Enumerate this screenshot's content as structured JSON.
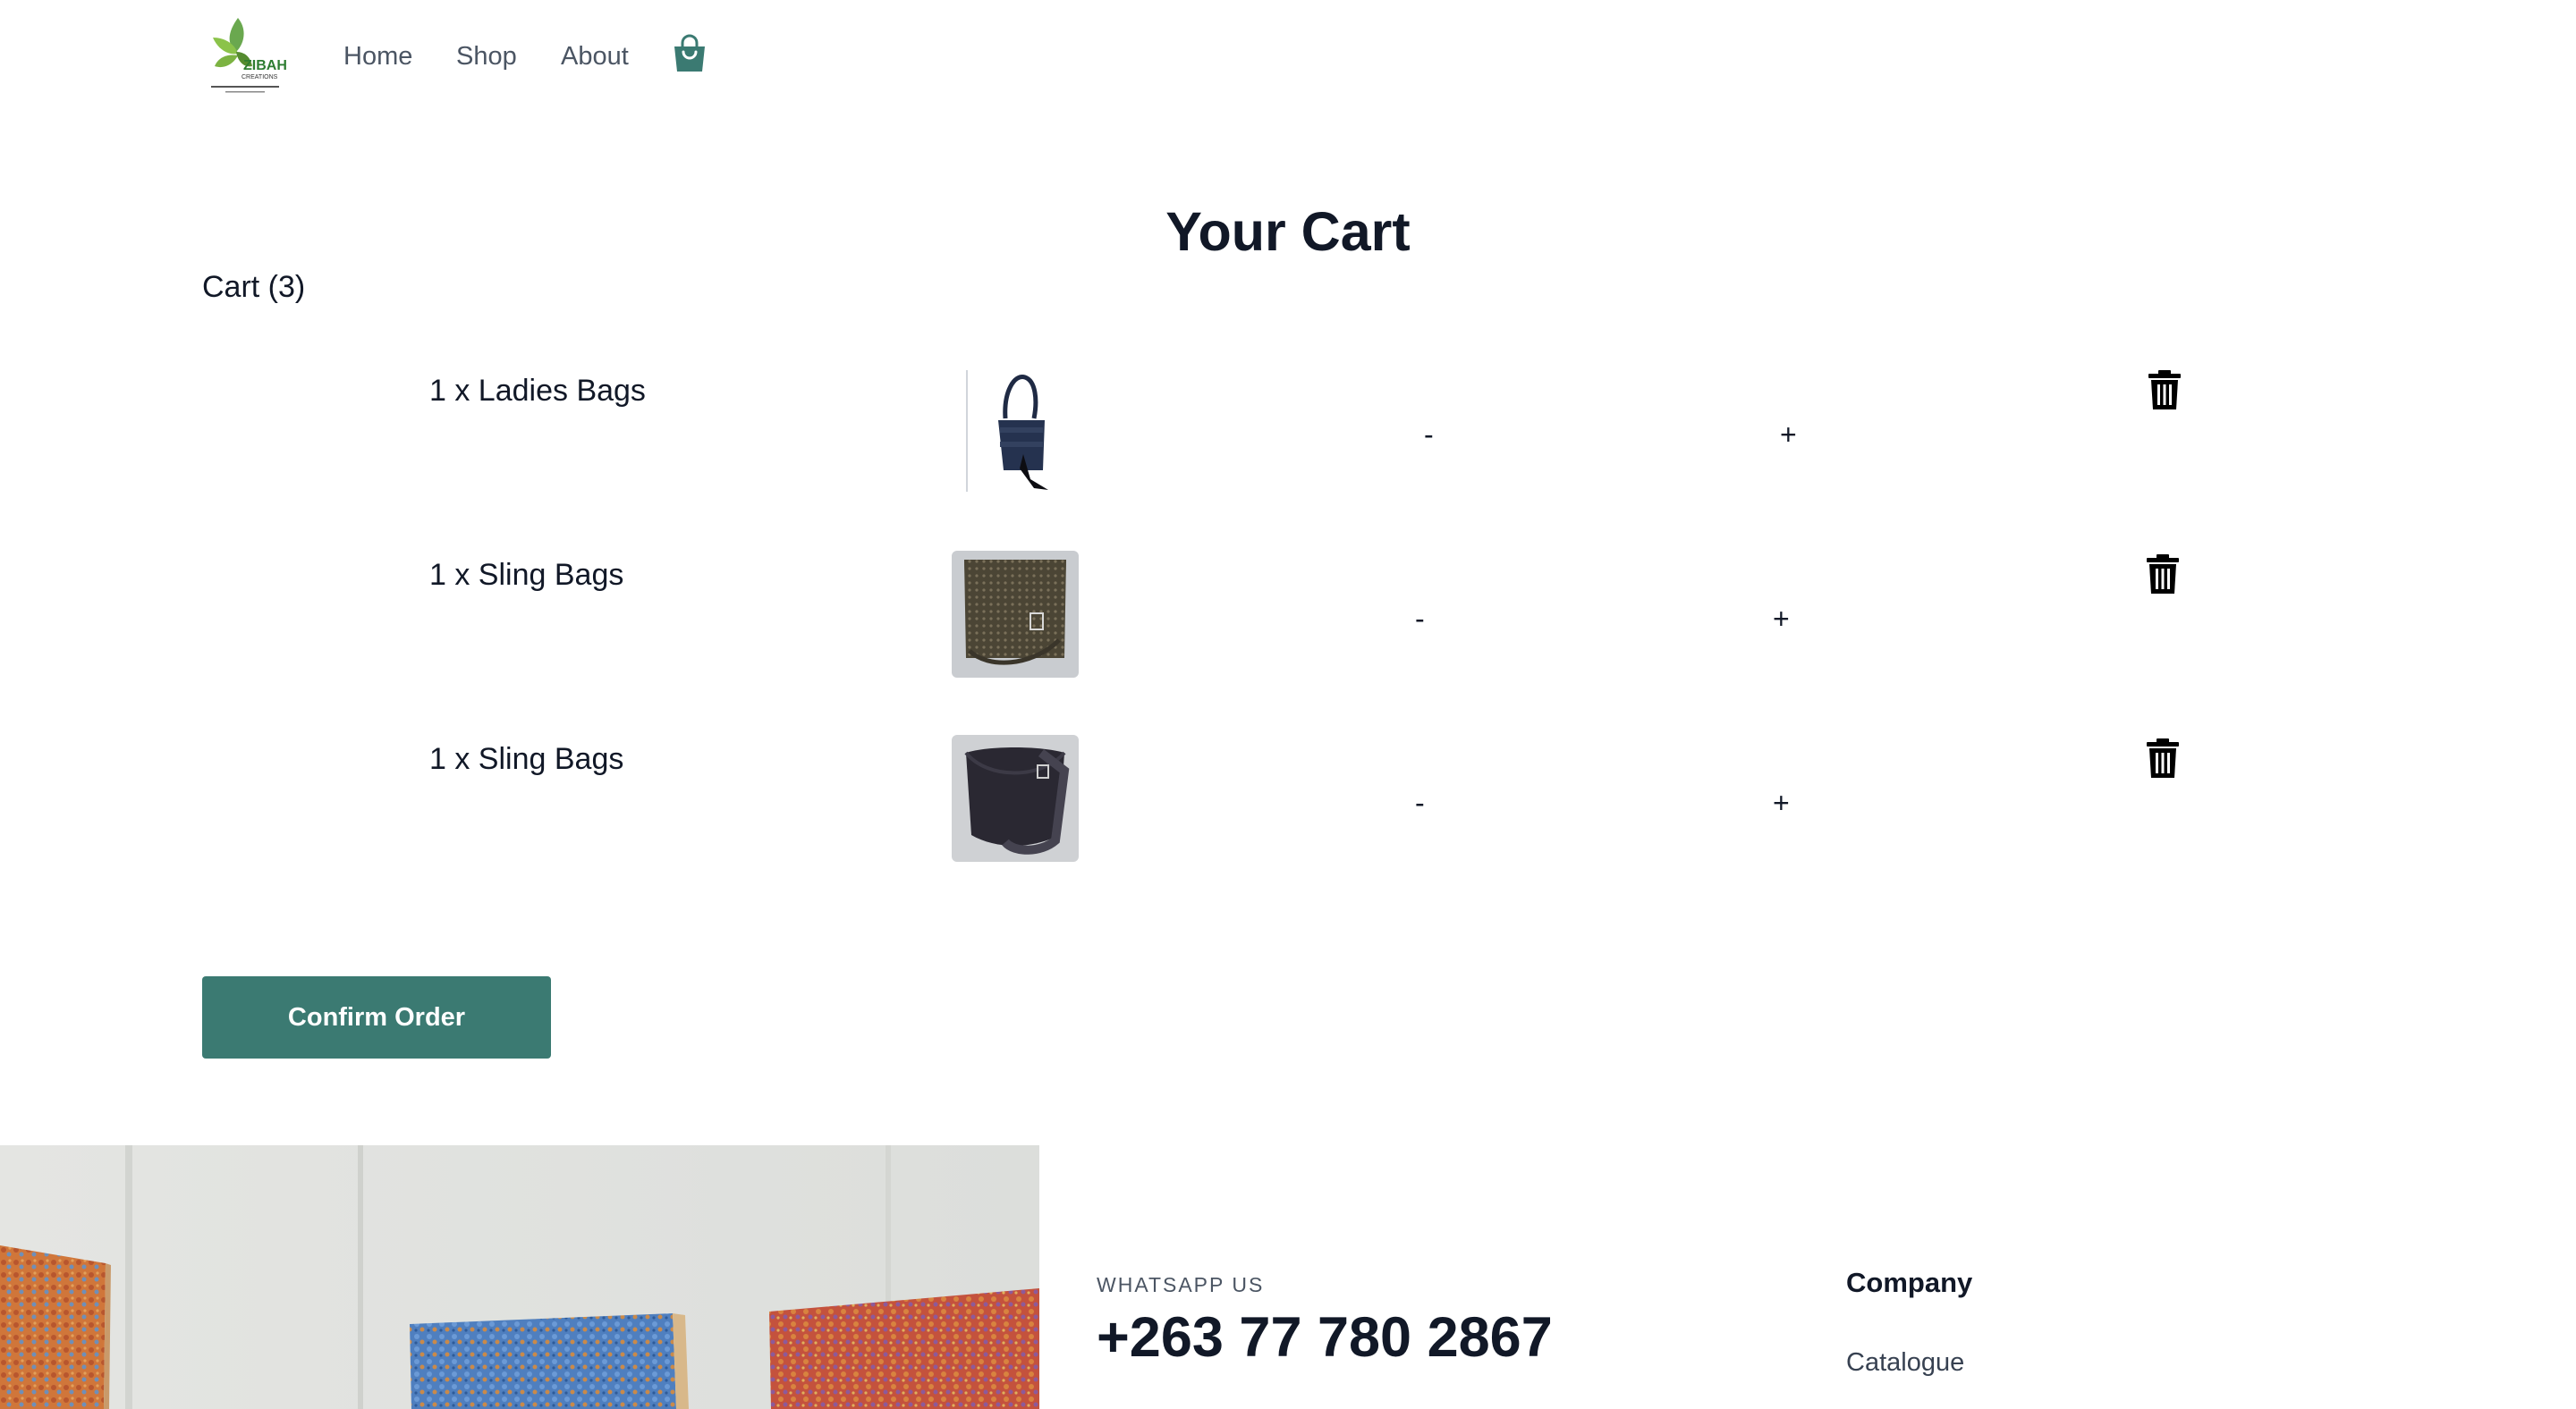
{
  "nav": {
    "logo_text": "ZIBAH",
    "logo_subtext": "CREATIONS",
    "links": [
      "Home",
      "Shop",
      "About"
    ]
  },
  "cart": {
    "title": "Your Cart",
    "count_label": "Cart (3)",
    "items": [
      {
        "name": "1 x Ladies Bags",
        "minus": "-",
        "plus": "+"
      },
      {
        "name": "1 x Sling Bags",
        "minus": "-",
        "plus": "+"
      },
      {
        "name": "1 x Sling Bags",
        "minus": "-",
        "plus": "+"
      }
    ],
    "confirm_label": "Confirm Order"
  },
  "footer": {
    "whatsapp_label": "WHATSAPP US",
    "whatsapp_number": "+263 77 780 2867",
    "company_title": "Company",
    "company_links": [
      "Catalogue"
    ]
  },
  "colors": {
    "accent": "#3b7a72",
    "text_dark": "#111827",
    "text_muted": "#4b5563"
  }
}
